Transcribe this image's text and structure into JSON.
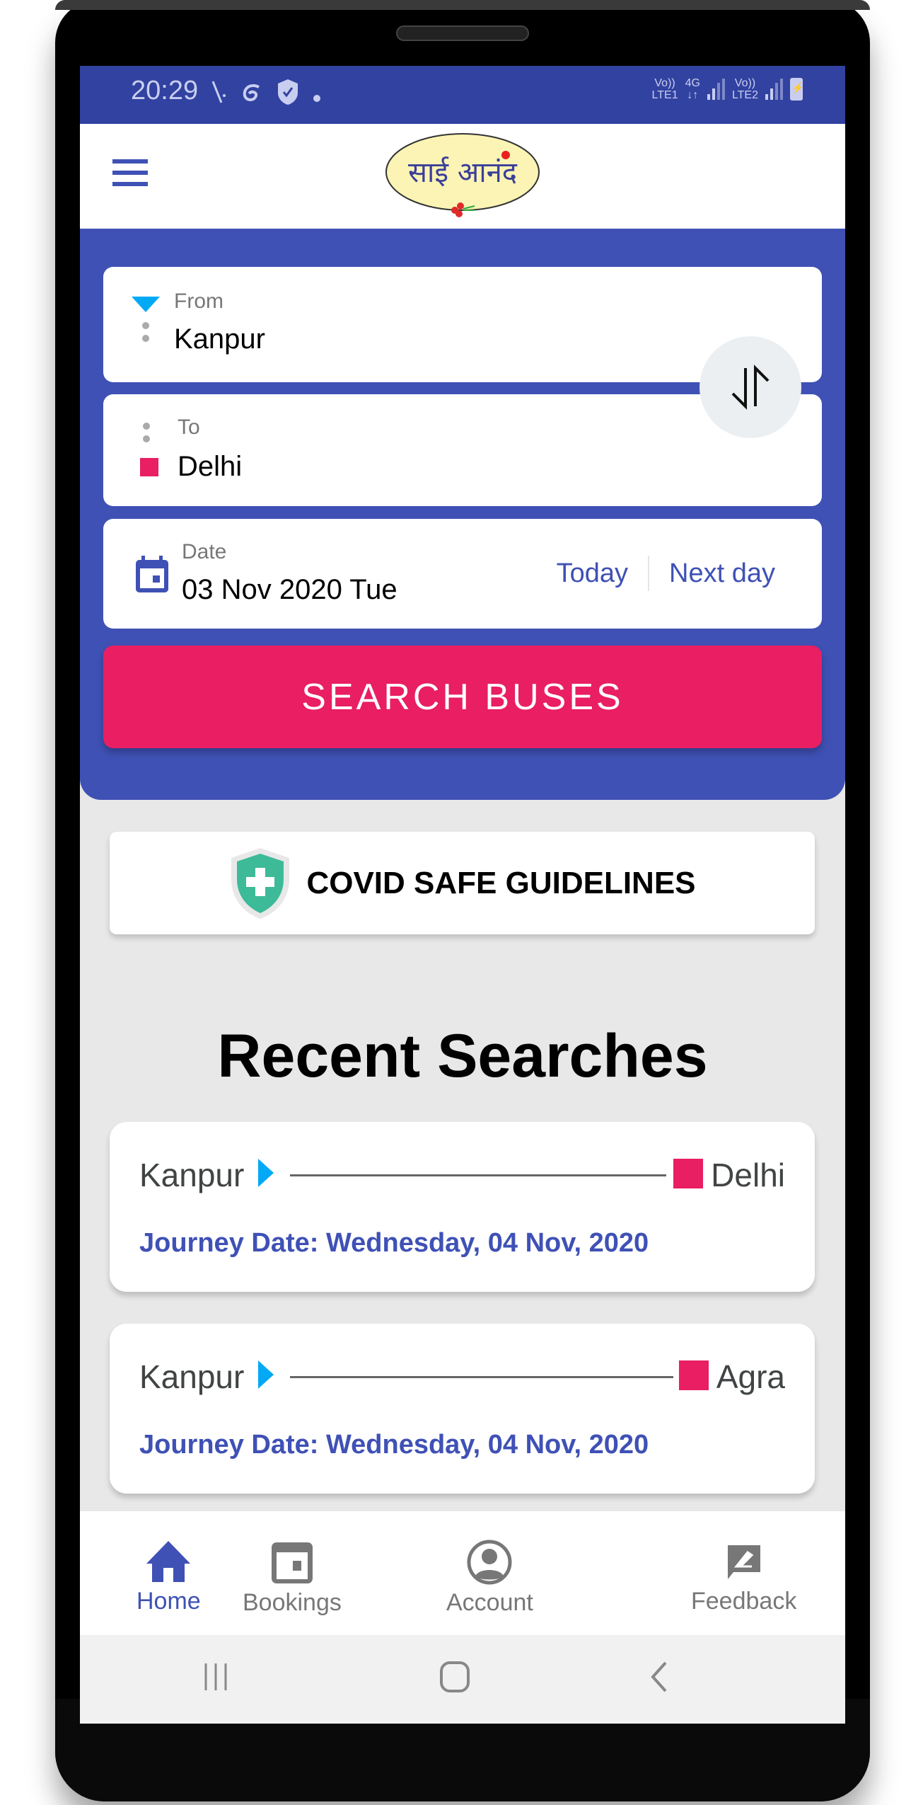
{
  "status_bar": {
    "time": "20:29",
    "left_icons": [
      "missed-call-icon",
      "swirl-app-icon",
      "shield-check-icon",
      "dot-icon"
    ],
    "sim1": {
      "top": "Vo))",
      "bottom": "LTE1"
    },
    "network": {
      "top": "4G",
      "bottom": "↓↑"
    },
    "sim2": {
      "top": "Vo))",
      "bottom": "LTE2"
    },
    "battery": "charging"
  },
  "app_bar": {
    "menu_icon": "hamburger-menu-icon",
    "logo_text": "साई आनंद"
  },
  "search_form": {
    "from": {
      "label": "From",
      "value": "Kanpur"
    },
    "to": {
      "label": "To",
      "value": "Delhi"
    },
    "swap_icon": "swap-vertical-icon",
    "date": {
      "label": "Date",
      "value": "03 Nov 2020 Tue",
      "today_label": "Today",
      "next_day_label": "Next day"
    },
    "search_button_label": "SEARCH BUSES"
  },
  "covid": {
    "label": "COVID SAFE GUIDELINES"
  },
  "recent": {
    "title": "Recent Searches",
    "items": [
      {
        "from": "Kanpur",
        "to": "Delhi",
        "date": "Journey Date: Wednesday, 04 Nov, 2020"
      },
      {
        "from": "Kanpur",
        "to": "Agra",
        "date": "Journey Date: Wednesday, 04 Nov, 2020"
      }
    ]
  },
  "bottom_nav": {
    "items": [
      {
        "label": "Home",
        "icon": "home-icon",
        "active": true
      },
      {
        "label": "Bookings",
        "icon": "calendar-icon",
        "active": false
      },
      {
        "label": "Account",
        "icon": "account-circle-icon",
        "active": false
      },
      {
        "label": "Feedback",
        "icon": "feedback-icon",
        "active": false
      }
    ]
  },
  "colors": {
    "primary": "#3f51b5",
    "status_bar": "#3242a0",
    "accent": "#e91e63",
    "origin_marker": "#03a9f4",
    "covid_green": "#3dba98"
  }
}
